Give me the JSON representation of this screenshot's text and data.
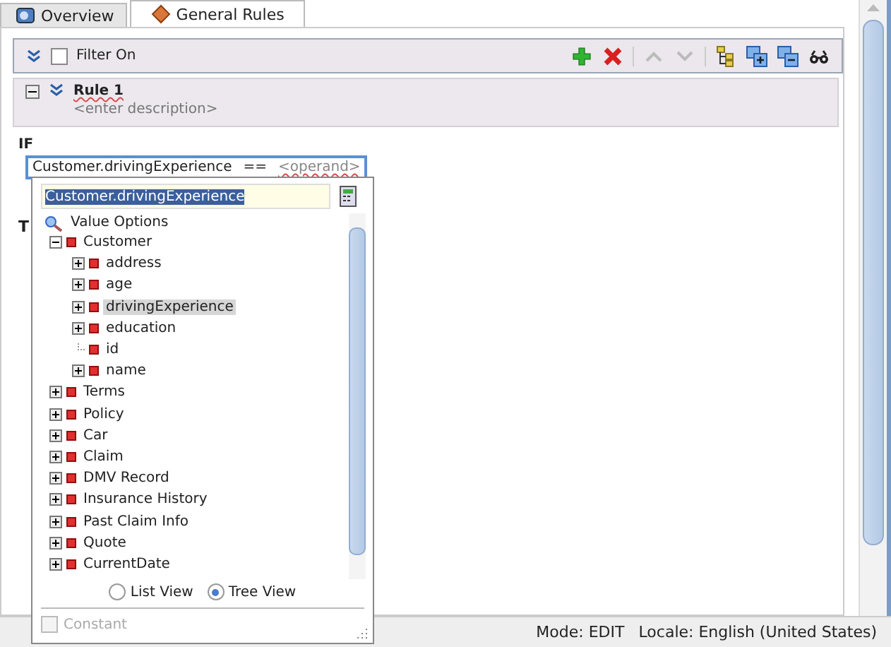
{
  "tabs": [
    {
      "label": "Overview",
      "selected": false,
      "kind": "overview"
    },
    {
      "label": "General Rules",
      "selected": true,
      "kind": "rules"
    }
  ],
  "toolbar": {
    "filter": {
      "label": "Filter On",
      "checked": false
    },
    "actions": [
      {
        "kind": "add",
        "disabled": false
      },
      {
        "kind": "delete",
        "disabled": false
      },
      {
        "kind": "separator",
        "disabled": false
      },
      {
        "kind": "up",
        "disabled": true
      },
      {
        "kind": "down",
        "disabled": true
      },
      {
        "kind": "separator",
        "disabled": false
      },
      {
        "kind": "tree",
        "disabled": false
      },
      {
        "kind": "expand",
        "disabled": false
      },
      {
        "kind": "collapse",
        "disabled": false
      },
      {
        "kind": "find",
        "disabled": false
      }
    ]
  },
  "rule": {
    "title": "Rule 1",
    "description": "<enter description>",
    "expanded": true
  },
  "if_label": "IF",
  "condition": {
    "left": "Customer.drivingExperience",
    "operator": "==",
    "operand": "<operand>"
  },
  "then_label": "T",
  "popup": {
    "value": "Customer.drivingExperience",
    "heading": "Value Options",
    "tree": [
      {
        "label": "Customer",
        "expandable": true,
        "expanded": true,
        "selected": false,
        "children": [
          {
            "label": "address",
            "expandable": true,
            "expanded": false,
            "selected": false
          },
          {
            "label": "age",
            "expandable": true,
            "expanded": false,
            "selected": false
          },
          {
            "label": "drivingExperience",
            "expandable": true,
            "expanded": false,
            "selected": true
          },
          {
            "label": "education",
            "expandable": true,
            "expanded": false,
            "selected": false
          },
          {
            "label": "id",
            "expandable": false,
            "expanded": false,
            "selected": false
          },
          {
            "label": "name",
            "expandable": true,
            "expanded": false,
            "selected": false
          }
        ]
      },
      {
        "label": "Terms",
        "expandable": true,
        "expanded": false,
        "selected": false
      },
      {
        "label": "Policy",
        "expandable": true,
        "expanded": false,
        "selected": false
      },
      {
        "label": "Car",
        "expandable": true,
        "expanded": false,
        "selected": false
      },
      {
        "label": "Claim",
        "expandable": true,
        "expanded": false,
        "selected": false
      },
      {
        "label": "DMV Record",
        "expandable": true,
        "expanded": false,
        "selected": false
      },
      {
        "label": "Insurance History",
        "expandable": true,
        "expanded": false,
        "selected": false
      },
      {
        "label": "Past Claim Info",
        "expandable": true,
        "expanded": false,
        "selected": false
      },
      {
        "label": "Quote",
        "expandable": true,
        "expanded": false,
        "selected": false
      },
      {
        "label": "CurrentDate",
        "expandable": true,
        "expanded": false,
        "selected": false
      }
    ],
    "views": [
      {
        "label": "List View",
        "selected": false
      },
      {
        "label": "Tree View",
        "selected": true
      }
    ],
    "constant": {
      "label": "Constant",
      "checked": false,
      "disabled": true
    }
  },
  "status_bar": {
    "mode": "Mode: EDIT",
    "locale": "Locale: English (United States)"
  }
}
